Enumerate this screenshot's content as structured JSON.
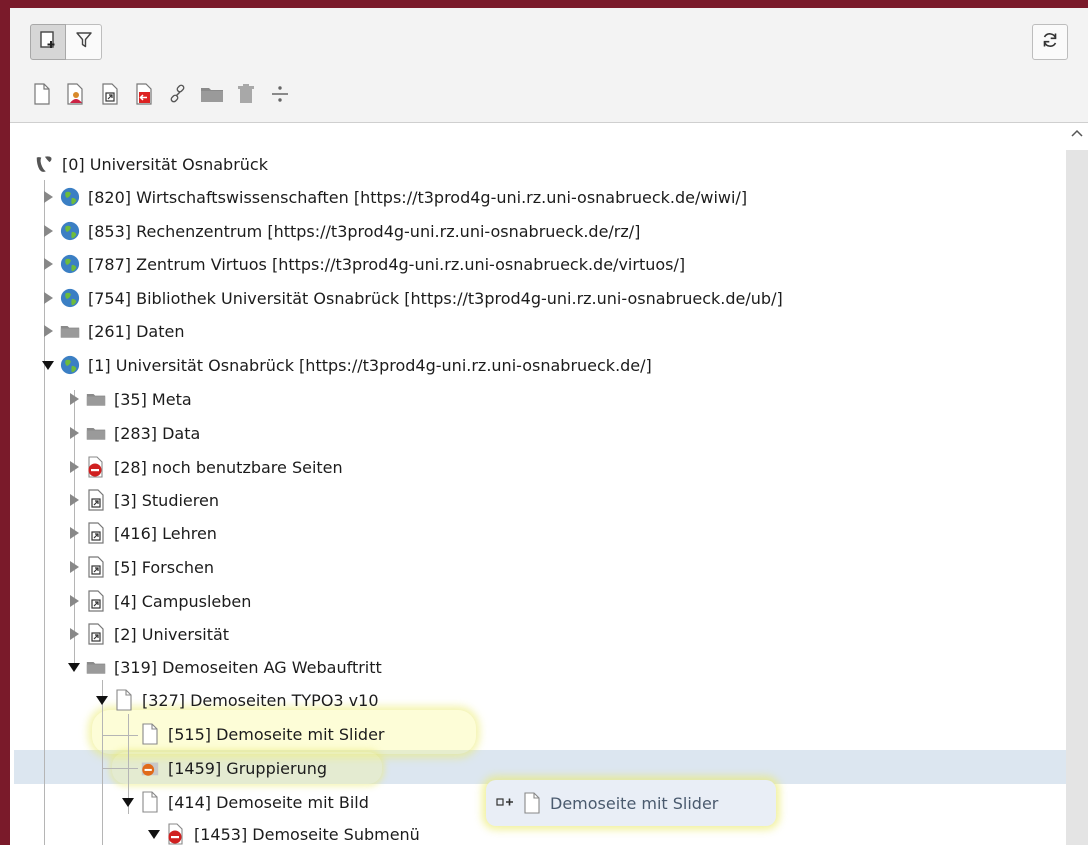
{
  "colors": {
    "frame": "#7a1a2a",
    "selection": "#dce6f0",
    "highlight": "#f4f48c"
  },
  "toolbar": {
    "new_page_icon": "new-page-icon",
    "filter_icon": "filter-icon",
    "refresh_icon": "refresh-icon",
    "dnd_icons": [
      "standard-page-icon",
      "backend-user-section-icon",
      "shortcut-page-icon",
      "mount-point-page-icon",
      "external-link-icon",
      "folder-icon",
      "recycler-icon",
      "menu-separator-icon"
    ]
  },
  "tree": {
    "root": {
      "label": "[0] Universität Osnabrück",
      "icon": "typo3-logo-icon"
    },
    "nodes": [
      {
        "label": "[820] Wirtschaftswissenschaften [https://t3prod4g-uni.rz.uni-osnabrueck.de/wiwi/]",
        "icon": "globe-icon",
        "state": "collapsed"
      },
      {
        "label": "[853] Rechenzentrum [https://t3prod4g-uni.rz.uni-osnabrueck.de/rz/]",
        "icon": "globe-icon",
        "state": "collapsed"
      },
      {
        "label": "[787] Zentrum Virtuos [https://t3prod4g-uni.rz.uni-osnabrueck.de/virtuos/]",
        "icon": "globe-icon",
        "state": "collapsed"
      },
      {
        "label": "[754] Bibliothek Universität Osnabrück [https://t3prod4g-uni.rz.uni-osnabrueck.de/ub/]",
        "icon": "globe-icon",
        "state": "collapsed"
      },
      {
        "label": "[261] Daten",
        "icon": "folder-icon",
        "state": "collapsed"
      },
      {
        "label": "[1] Universität Osnabrück [https://t3prod4g-uni.rz.uni-osnabrueck.de/]",
        "icon": "globe-icon",
        "state": "expanded"
      },
      {
        "label": "[35] Meta",
        "icon": "folder-icon",
        "state": "collapsed"
      },
      {
        "label": "[283] Data",
        "icon": "folder-icon",
        "state": "collapsed"
      },
      {
        "label": "[28] noch benutzbare Seiten",
        "icon": "hidden-page-icon",
        "state": "collapsed"
      },
      {
        "label": "[3] Studieren",
        "icon": "shortcut-page-icon",
        "state": "collapsed"
      },
      {
        "label": "[416] Lehren",
        "icon": "shortcut-page-icon",
        "state": "collapsed"
      },
      {
        "label": "[5] Forschen",
        "icon": "shortcut-page-icon",
        "state": "collapsed"
      },
      {
        "label": "[4] Campusleben",
        "icon": "shortcut-page-icon",
        "state": "collapsed"
      },
      {
        "label": "[2] Universität",
        "icon": "shortcut-page-icon",
        "state": "collapsed"
      },
      {
        "label": "[319] Demoseiten AG Webauftritt",
        "icon": "folder-icon",
        "state": "expanded"
      },
      {
        "label": "[327] Demoseiten TYPO3 v10",
        "icon": "page-icon",
        "state": "expanded"
      },
      {
        "label": "[515] Demoseite mit Slider",
        "icon": "page-icon",
        "state": "leaf"
      },
      {
        "label": "[1459] Gruppierung",
        "icon": "group-page-icon",
        "state": "leaf"
      },
      {
        "label": "[414] Demoseite mit Bild",
        "icon": "page-icon",
        "state": "expanded"
      },
      {
        "label": "[1453] Demoseite Submenü",
        "icon": "hidden-page-icon",
        "state": "expanded"
      }
    ]
  },
  "drag_tooltip": {
    "label": "Demoseite mit Slider",
    "icon": "page-icon",
    "action_icon": "insert-after-icon"
  }
}
